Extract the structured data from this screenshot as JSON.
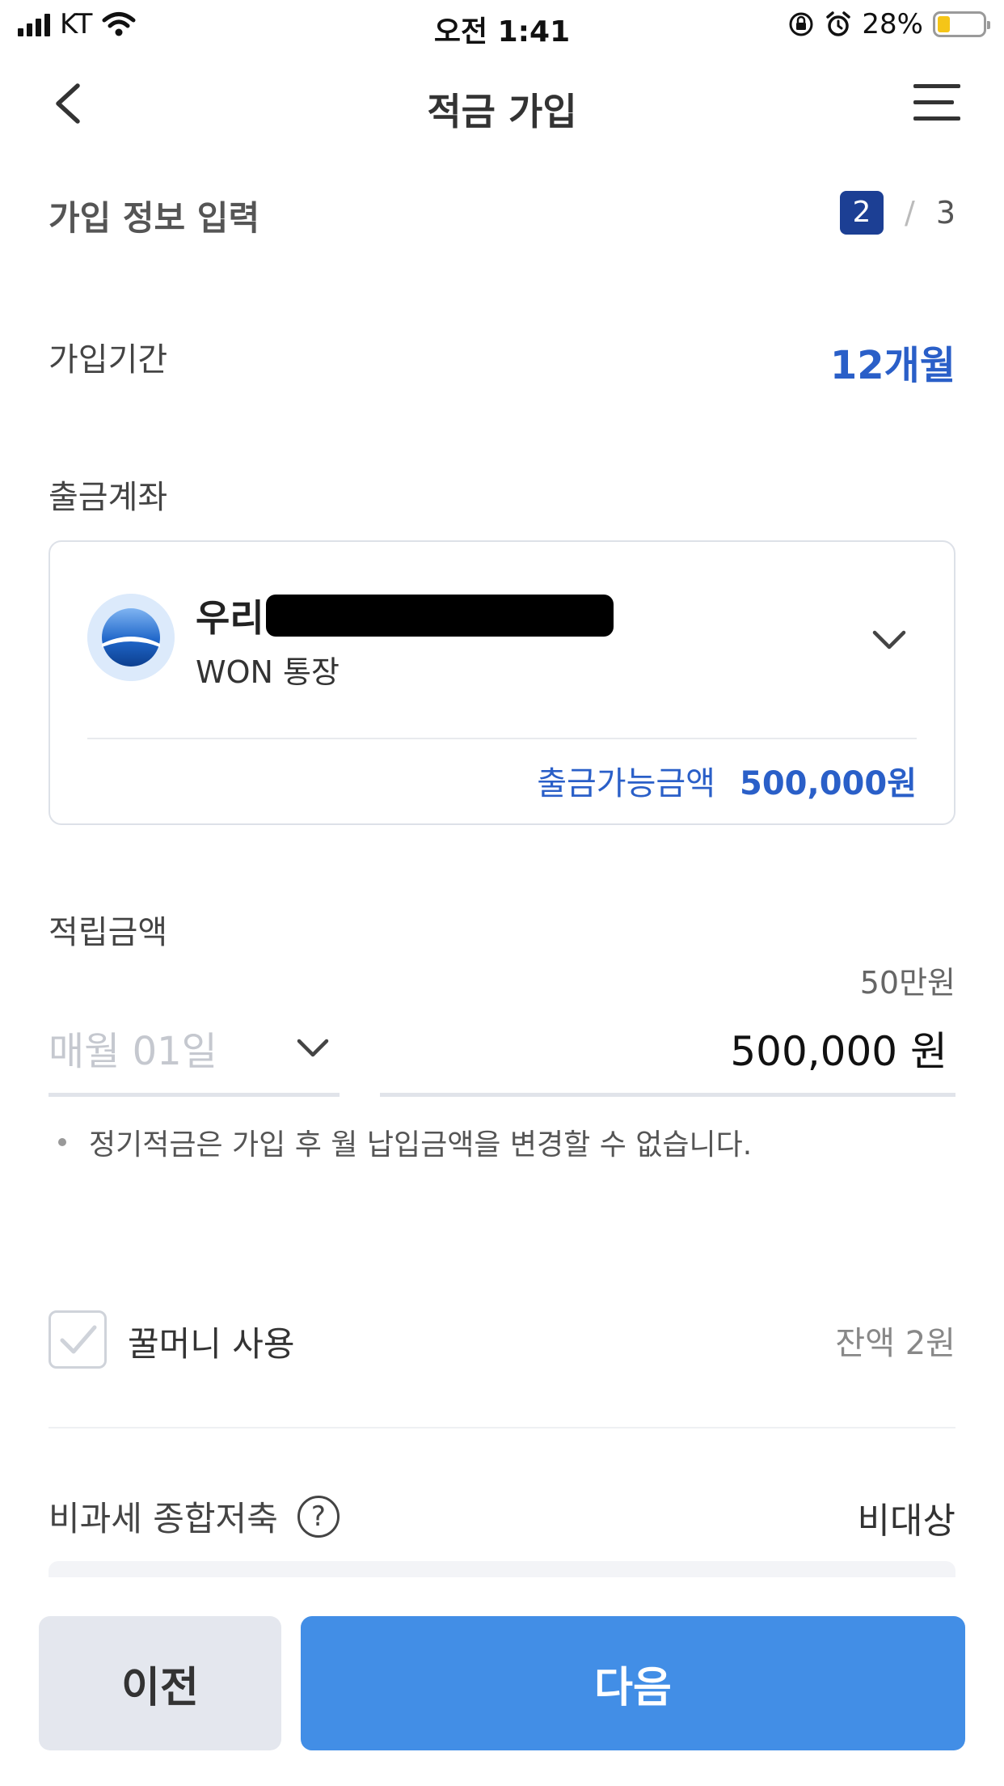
{
  "status_bar": {
    "carrier": "KT",
    "time": "오전 1:41",
    "battery_percent": "28%",
    "battery_level": 0.28
  },
  "nav": {
    "title": "적금 가입"
  },
  "step": {
    "title": "가입 정보 입력",
    "current": "2",
    "separator": "/",
    "total": "3"
  },
  "period": {
    "label": "가입기간",
    "value": "12개월"
  },
  "account": {
    "label": "출금계좌",
    "bank_name": "우리",
    "account_type": "WON 통장",
    "available_label": "출금가능금액",
    "available_amount": "500,000원"
  },
  "deposit": {
    "label": "적립금액",
    "date_placeholder": "매월 01일",
    "amount_hint": "50만원",
    "amount": "500,000 원",
    "note": "정기적금은 가입 후 월 납입금액을 변경할 수 없습니다."
  },
  "honey_money": {
    "label": "꿀머니 사용",
    "balance": "잔액 2원",
    "checked": false
  },
  "tax": {
    "label": "비과세 종합저축",
    "help_symbol": "?",
    "value": "비대상"
  },
  "buttons": {
    "prev": "이전",
    "next": "다음"
  },
  "colors": {
    "accent_blue": "#2a5fc8",
    "step_badge": "#1c3f94",
    "next_button": "#428ee6",
    "prev_button": "#e4e7ee",
    "battery_fill": "#f5c518"
  }
}
